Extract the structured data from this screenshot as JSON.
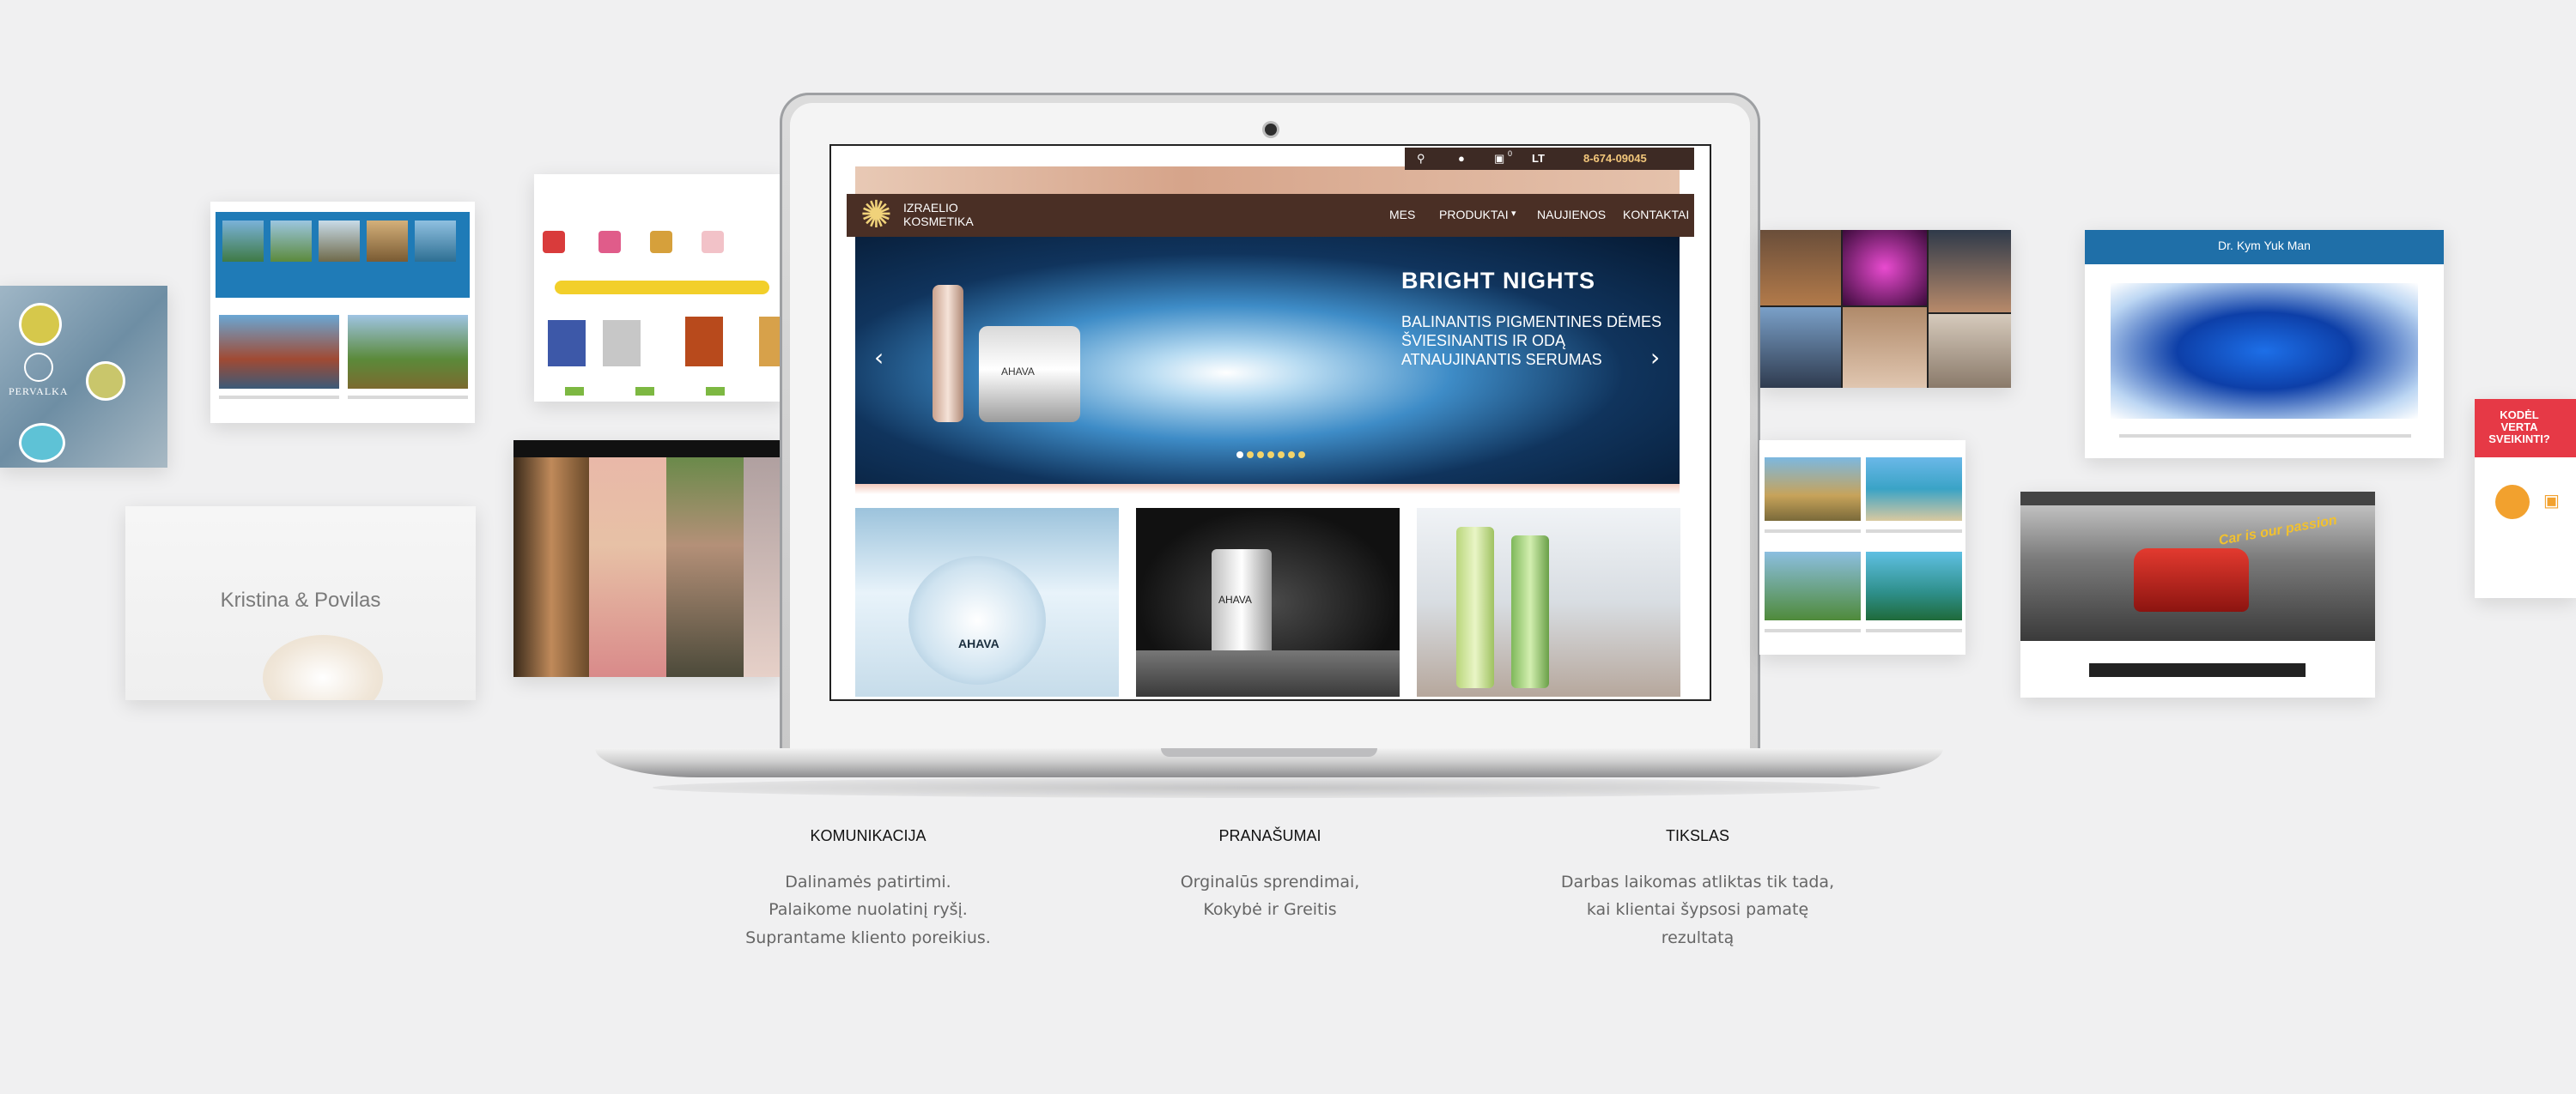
{
  "screen_site": {
    "phone": "8-674-09045",
    "lang": "LT",
    "cart_count": "0",
    "logo": {
      "line1": "IZRAELIO",
      "line2": "KOSMETIKA"
    },
    "nav": [
      "MES",
      "PRODUKTAI",
      "NAUJIENOS",
      "KONTAKTAI"
    ],
    "hero": {
      "title": "BRIGHT NIGHTS",
      "lines": [
        "BALINANTIS PIGMENTINES DĖMES",
        "ŠVIESINANTIS IR ODĄ",
        "ATNAUJINANTIS SERUMAS"
      ],
      "slides": 7,
      "active_slide": 1
    },
    "brand": "AHAVA"
  },
  "thumbs": {
    "wedding_name": "Kristina & Povilas",
    "doctor_name": "Dr. Kym Yuk Man",
    "car_tagline": "Car is our passion",
    "promo_question": "KODĖL VERTA SVEIKINTI?",
    "pervalka_label": "PERVALKA"
  },
  "features": [
    {
      "title": "KOMUNIKACIJA",
      "lines": [
        "Dalinamės patirtimi.",
        "Palaikome nuolatinį ryšį.",
        "Suprantame kliento poreikius."
      ]
    },
    {
      "title": "PRANAŠUMAI",
      "lines": [
        "Orginalūs sprendimai,",
        "Kokybė ir Greitis"
      ]
    },
    {
      "title": "TIKSLAS",
      "lines": [
        "Darbas laikomas atliktas tik tada,",
        "kai klientai šypsosi pamatę",
        "rezultatą"
      ]
    }
  ],
  "colors": {
    "background": "#f0f0f1",
    "site_brown": "#4a2f25",
    "site_header_dark": "#3d2a24",
    "doctor_blue": "#1f6fa8",
    "promo_red": "#e63946",
    "travel_blue": "#2a9fd6"
  }
}
